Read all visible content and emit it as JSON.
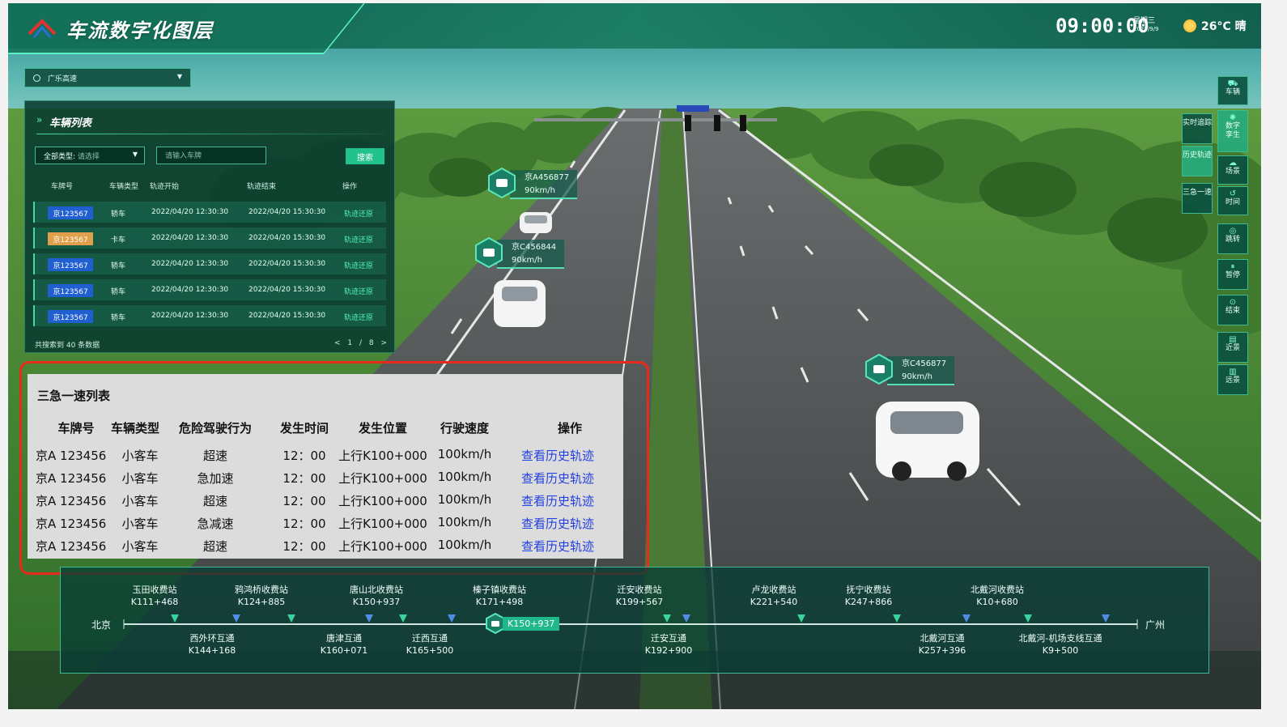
{
  "header": {
    "title": "车流数字化图层",
    "time": "09:00:00",
    "weekday": "星期三",
    "date": "2023/9/9",
    "weather": "26°C 晴",
    "colors": {
      "primary": "#1fb88a",
      "accent": "#42d9a6",
      "highlight_border": "#e82a1b",
      "link": "#2440e0"
    }
  },
  "road_select": {
    "value": "广乐高速"
  },
  "vehicle_panel": {
    "title": "车辆列表",
    "type_filter_label": "全部类型:",
    "type_filter_placeholder": "请选择",
    "plate_placeholder": "请输入车牌",
    "search_label": "搜索",
    "headers": [
      "车牌号",
      "车辆类型",
      "轨迹开始",
      "轨迹结束",
      "操作"
    ],
    "rows": [
      {
        "plate": "京123567",
        "plate_color": "#1f5fd0",
        "type": "轿车",
        "start": "2022/04/20 12:30:30",
        "end": "2022/04/20 15:30:30",
        "action": "轨迹还原"
      },
      {
        "plate": "京123567",
        "plate_color": "#e0a04a",
        "type": "卡车",
        "start": "2022/04/20 12:30:30",
        "end": "2022/04/20 15:30:30",
        "action": "轨迹还原"
      },
      {
        "plate": "京123567",
        "plate_color": "#1f5fd0",
        "type": "轿车",
        "start": "2022/04/20 12:30:30",
        "end": "2022/04/20 15:30:30",
        "action": "轨迹还原"
      },
      {
        "plate": "京123567",
        "plate_color": "#1f5fd0",
        "type": "轿车",
        "start": "2022/04/20 12:30:30",
        "end": "2022/04/20 15:30:30",
        "action": "轨迹还原"
      },
      {
        "plate": "京123567",
        "plate_color": "#1f5fd0",
        "type": "轿车",
        "start": "2022/04/20 12:30:30",
        "end": "2022/04/20 15:30:30",
        "action": "轨迹还原"
      }
    ],
    "footer": "共搜索到 40 条数据",
    "pager": {
      "prev": "<",
      "page": "1 / 8",
      "next": ">"
    }
  },
  "toolbar": {
    "main": [
      {
        "label": "车辆",
        "icon": "car-icon"
      },
      {
        "label": "数字孪生",
        "icon": "twin-icon"
      },
      {
        "label": "场景",
        "icon": "scene-icon"
      },
      {
        "label": "时间",
        "icon": "time-icon"
      },
      {
        "label": "跳转",
        "icon": "jump-icon"
      },
      {
        "label": "暂停",
        "icon": "pause-icon"
      },
      {
        "label": "结束",
        "icon": "stop-icon"
      },
      {
        "label": "近景",
        "icon": "near-view-icon"
      },
      {
        "label": "远景",
        "icon": "far-view-icon"
      }
    ],
    "side": [
      {
        "label": "实时追踪"
      },
      {
        "label": "历史轨迹"
      },
      {
        "label": "三急一速"
      }
    ]
  },
  "car_tags": [
    {
      "plate": "京A456877",
      "speed": "90km/h"
    },
    {
      "plate": "京C456844",
      "speed": "90km/h"
    },
    {
      "plate": "京C456877",
      "speed": "90km/h"
    }
  ],
  "danger_table": {
    "title": "三急一速列表",
    "headers": [
      "车牌号",
      "车辆类型",
      "危险驾驶行为",
      "发生时间",
      "发生位置",
      "行驶速度",
      "操作"
    ],
    "rows": [
      {
        "plate": "京A 123456",
        "type": "小客车",
        "behavior": "超速",
        "time": "12：00",
        "location": "上行K100+000",
        "speed": "100km/h",
        "action": "查看历史轨迹"
      },
      {
        "plate": "京A 123456",
        "type": "小客车",
        "behavior": "急加速",
        "time": "12：00",
        "location": "上行K100+000",
        "speed": "100km/h",
        "action": "查看历史轨迹"
      },
      {
        "plate": "京A 123456",
        "type": "小客车",
        "behavior": "超速",
        "time": "12：00",
        "location": "上行K100+000",
        "speed": "100km/h",
        "action": "查看历史轨迹"
      },
      {
        "plate": "京A 123456",
        "type": "小客车",
        "behavior": "急减速",
        "time": "12：00",
        "location": "上行K100+000",
        "speed": "100km/h",
        "action": "查看历史轨迹"
      },
      {
        "plate": "京A 123456",
        "type": "小客车",
        "behavior": "超速",
        "time": "12：00",
        "location": "上行K100+000",
        "speed": "100km/h",
        "action": "查看历史轨迹"
      }
    ]
  },
  "timeline": {
    "start": "北京",
    "end": "广州",
    "current": "K150+937",
    "upper": [
      {
        "name": "玉田收费站",
        "km": "K111+468"
      },
      {
        "name": "鸦鸿桥收费站",
        "km": "K124+885"
      },
      {
        "name": "唐山北收费站",
        "km": "K150+937"
      },
      {
        "name": "榛子镇收费站",
        "km": "K171+498"
      },
      {
        "name": "迁安收费站",
        "km": "K199+567"
      },
      {
        "name": "卢龙收费站",
        "km": "K221+540"
      },
      {
        "name": "抚宁收费站",
        "km": "K247+866"
      },
      {
        "name": "北戴河收费站",
        "km": "K10+680"
      }
    ],
    "lower": [
      {
        "name": "西外环互通",
        "km": "K144+168"
      },
      {
        "name": "唐津互通",
        "km": "K160+071"
      },
      {
        "name": "迁西互通",
        "km": "K165+500"
      },
      {
        "name": "迁安互通",
        "km": "K192+900"
      },
      {
        "name": "北戴河互通",
        "km": "K257+396"
      },
      {
        "name": "北戴河-机场支线互通",
        "km": "K9+500"
      }
    ]
  }
}
